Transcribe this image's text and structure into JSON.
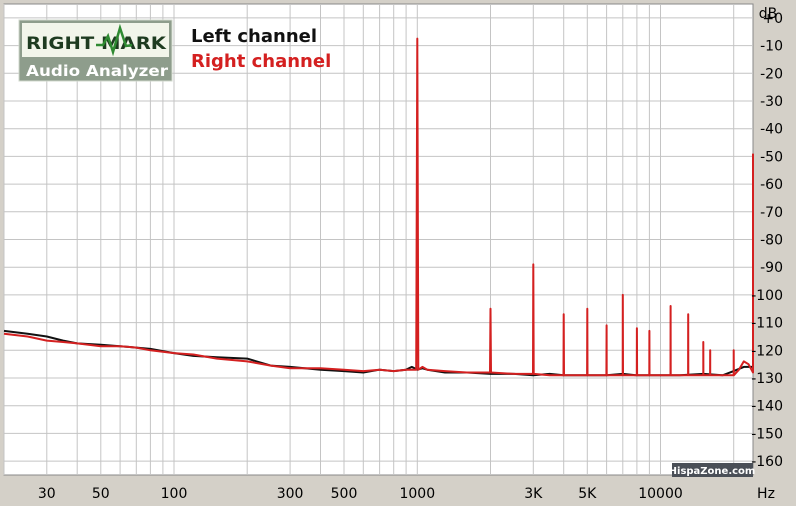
{
  "logo": {
    "top": "RIGHT MARK",
    "bottom": "Audio Analyzer"
  },
  "legend": [
    {
      "label": "Left channel",
      "color": "#111111"
    },
    {
      "label": "Right channel",
      "color": "#d42020"
    }
  ],
  "watermark": "HispaZone.com",
  "chart_data": {
    "type": "line",
    "title": "",
    "xlabel": "Hz",
    "ylabel": "dB",
    "xscale": "log",
    "xlim": [
      20,
      24000
    ],
    "ylim": [
      -165,
      5
    ],
    "grid": true,
    "legend_position": "top-left",
    "x_tick_labels": [
      "30",
      "50",
      "100",
      "300",
      "500",
      "1000",
      "3K",
      "5K",
      "10000"
    ],
    "x_tick_values": [
      30,
      50,
      100,
      300,
      500,
      1000,
      3000,
      5000,
      10000
    ],
    "y_tick_labels": [
      "+0",
      "-10",
      "-20",
      "-30",
      "-40",
      "-50",
      "-60",
      "-70",
      "-80",
      "-90",
      "-100",
      "-110",
      "-120",
      "-130",
      "-140",
      "-150",
      "-160"
    ],
    "y_tick_values": [
      0,
      -10,
      -20,
      -30,
      -40,
      -50,
      -60,
      -70,
      -80,
      -90,
      -100,
      -110,
      -120,
      -130,
      -140,
      -150,
      -160
    ],
    "series": [
      {
        "name": "Left channel",
        "color": "#111111",
        "x": [
          20,
          25,
          30,
          35,
          40,
          50,
          60,
          70,
          80,
          100,
          120,
          150,
          200,
          250,
          300,
          400,
          500,
          600,
          700,
          800,
          900,
          950,
          1000,
          1050,
          1100,
          1300,
          1600,
          2000,
          2500,
          3000,
          3500,
          4000,
          5000,
          6000,
          7000,
          8000,
          10000,
          12000,
          15000,
          18000,
          20000,
          22000,
          24000
        ],
        "y": [
          -113,
          -114,
          -115,
          -116.5,
          -117.5,
          -118,
          -118.5,
          -119,
          -119.5,
          -121,
          -122,
          -122.5,
          -123,
          -125.5,
          -126,
          -127,
          -127.5,
          -128,
          -127,
          -127.5,
          -127,
          -126,
          -127,
          -126.5,
          -127,
          -128,
          -128,
          -128.5,
          -128.5,
          -129,
          -128.5,
          -129,
          -129,
          -129,
          -128.5,
          -129,
          -129,
          -129,
          -128.5,
          -129,
          -127.5,
          -126,
          -126
        ]
      },
      {
        "name": "Right channel",
        "color": "#d42020",
        "x": [
          20,
          25,
          30,
          35,
          40,
          50,
          60,
          70,
          80,
          100,
          120,
          150,
          200,
          250,
          300,
          400,
          500,
          600,
          700,
          800,
          900,
          950,
          990,
          1000,
          1010,
          1050,
          1100,
          1300,
          1600,
          1990,
          2000,
          2010,
          2500,
          2990,
          3000,
          3010,
          3500,
          3990,
          4000,
          4010,
          4990,
          5000,
          5010,
          5990,
          6000,
          6010,
          6990,
          7000,
          7010,
          7990,
          8000,
          8010,
          8990,
          9000,
          9010,
          10000,
          10990,
          11000,
          11010,
          12990,
          13000,
          13010,
          14990,
          15000,
          15010,
          15990,
          16000,
          16010,
          17000,
          18000,
          19990,
          20000,
          20010,
          21000,
          22000,
          23000,
          23990,
          24000
        ],
        "y": [
          -114,
          -115,
          -116.5,
          -117,
          -117.5,
          -118.5,
          -118.5,
          -119,
          -120,
          -121,
          -121.5,
          -123,
          -124,
          -125.5,
          -126.5,
          -126.5,
          -127,
          -127.5,
          -127,
          -127.5,
          -127,
          -127,
          -127,
          -7.5,
          -127,
          -126,
          -127,
          -127.5,
          -128,
          -128,
          -105,
          -128,
          -128.5,
          -128.5,
          -89,
          -128.5,
          -129,
          -129,
          -107,
          -129,
          -129,
          -105,
          -129,
          -129,
          -111,
          -129,
          -129,
          -100,
          -129,
          -129,
          -112,
          -129,
          -129,
          -113,
          -129,
          -129,
          -129,
          -104,
          -129,
          -129,
          -107,
          -129,
          -129,
          -117,
          -129,
          -129,
          -120,
          -129,
          -129,
          -129,
          -129,
          -120,
          -129,
          -127,
          -124,
          -125,
          -128,
          -49
        ]
      }
    ]
  }
}
